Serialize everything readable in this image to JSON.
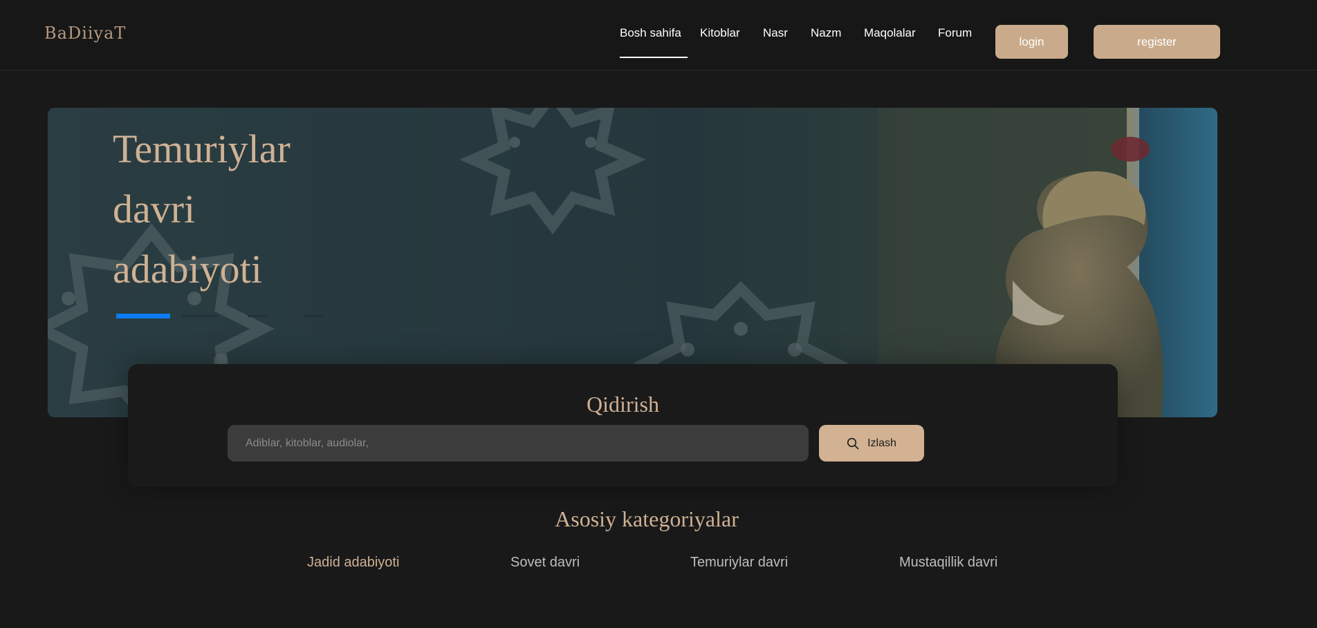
{
  "header": {
    "logo": "BaDiiyaT",
    "nav": [
      {
        "label": "Bosh sahifa",
        "active": true
      },
      {
        "label": "Kitoblar",
        "active": false
      },
      {
        "label": "Nasr",
        "active": false
      },
      {
        "label": "Nazm",
        "active": false
      },
      {
        "label": "Maqolalar",
        "active": false
      },
      {
        "label": "Forum",
        "active": false
      }
    ],
    "login_label": "login",
    "register_label": "register"
  },
  "hero": {
    "title_lines": [
      "Temuriylar",
      "davri",
      "adabiyoti"
    ],
    "slides_total": 4,
    "active_slide": 1
  },
  "search": {
    "title": "Qidirish",
    "placeholder": "Adiblar, kitoblar, audiolar,",
    "value": "",
    "button_label": "Izlash"
  },
  "categories": {
    "title": "Asosiy kategoriyalar",
    "items": [
      {
        "label": "Jadid adabiyoti",
        "highlight": true
      },
      {
        "label": "Sovet davri",
        "highlight": false
      },
      {
        "label": "Temuriylar davri",
        "highlight": false
      },
      {
        "label": "Mustaqillik davri",
        "highlight": false
      }
    ]
  },
  "colors": {
    "background": "#191919",
    "accent": "#c9ab8b",
    "hero_bg": "#273a3f",
    "indicator_active": "#0d7bf2"
  },
  "icons": {
    "search_button_icon": "search-icon"
  }
}
